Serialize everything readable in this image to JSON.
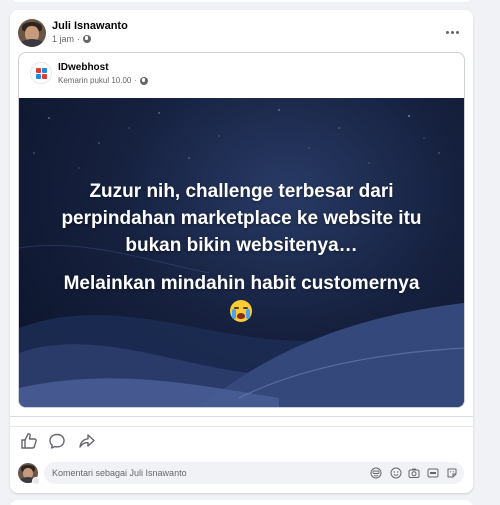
{
  "post": {
    "author": "Juli Isnawanto",
    "time": "1 jam",
    "separator": "·"
  },
  "shared": {
    "page_name": "IDwebhost",
    "time": "Kemarin pukul 10.00",
    "separator": "·",
    "headline": "Zuzur nih, challenge terbesar dari perpindahan marketplace ke website itu bukan bikin websitenya…",
    "subline": "Melainkan mindahin habit customernya"
  },
  "comment": {
    "placeholder": "Komentari sebagai Juli Isnawanto"
  },
  "icons": {
    "more": "more-horizontal-icon",
    "privacy": "globe-icon",
    "like": "thumbs-up-icon",
    "comment": "comment-bubble-icon",
    "share": "share-arrow-icon",
    "avatar_sticker": "avatar-sticker-icon",
    "emoji": "emoji-icon",
    "camera": "camera-icon",
    "gif": "gif-icon",
    "sticker": "sticker-icon",
    "emoji_in_banner": "crying-face-emoji"
  },
  "colors": {
    "background": "#f0f2f5",
    "card": "#ffffff",
    "banner_dark": "#0b1227",
    "banner_mid": "#283a66",
    "text_primary": "#050505",
    "text_secondary": "#65676b"
  }
}
